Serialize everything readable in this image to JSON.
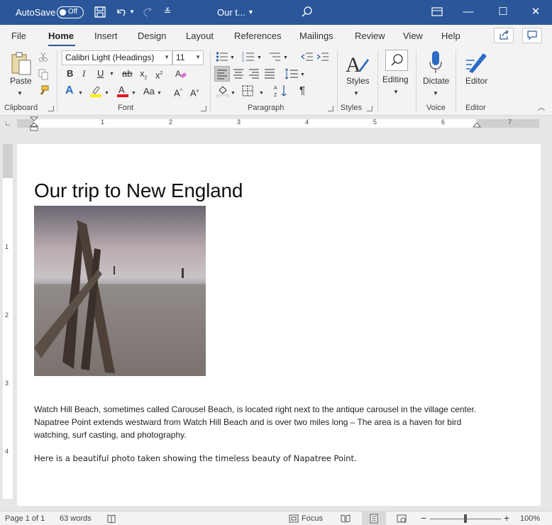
{
  "titlebar": {
    "autosave_label": "AutoSave",
    "autosave_state": "Off",
    "doc_title": "Our t...",
    "colors": {
      "bar": "#2b579a",
      "text": "#ffffff"
    }
  },
  "tabs": [
    {
      "label": "File"
    },
    {
      "label": "Home",
      "active": true
    },
    {
      "label": "Insert"
    },
    {
      "label": "Design"
    },
    {
      "label": "Layout"
    },
    {
      "label": "References"
    },
    {
      "label": "Mailings"
    },
    {
      "label": "Review"
    },
    {
      "label": "View"
    },
    {
      "label": "Help"
    }
  ],
  "ribbon": {
    "clipboard": {
      "paste_label": "Paste",
      "group_label": "Clipboard"
    },
    "font": {
      "font_name": "Calibri Light (Headings)",
      "font_size": "11",
      "group_label": "Font",
      "change_case_label": "Aa"
    },
    "paragraph": {
      "group_label": "Paragraph"
    },
    "styles": {
      "styles_label": "Styles",
      "group_label": "Styles"
    },
    "editing": {
      "editing_label": "Editing"
    },
    "voice": {
      "dictate_label": "Dictate",
      "group_label": "Voice"
    },
    "editor": {
      "editor_label": "Editor",
      "group_label": "Editor"
    }
  },
  "ruler": {
    "numbers": [
      "1",
      "2",
      "3",
      "4",
      "5",
      "6",
      "7"
    ]
  },
  "vruler": {
    "numbers": [
      "1",
      "2",
      "3",
      "4"
    ]
  },
  "document": {
    "heading": "Our trip to New England",
    "paragraph1": "Watch Hill Beach, sometimes called Carousel Beach, is located right next to the antique carousel in the village center. Napatree Point extends westward from Watch Hill Beach and is over two miles long – The area is a haven for bird watching, surf casting, and photography.",
    "paragraph2": "Here is a beautiful photo taken showing the timeless beauty of Napatree Point."
  },
  "statusbar": {
    "page": "Page 1 of 1",
    "words": "63 words",
    "focus_label": "Focus",
    "zoom": "100%"
  }
}
